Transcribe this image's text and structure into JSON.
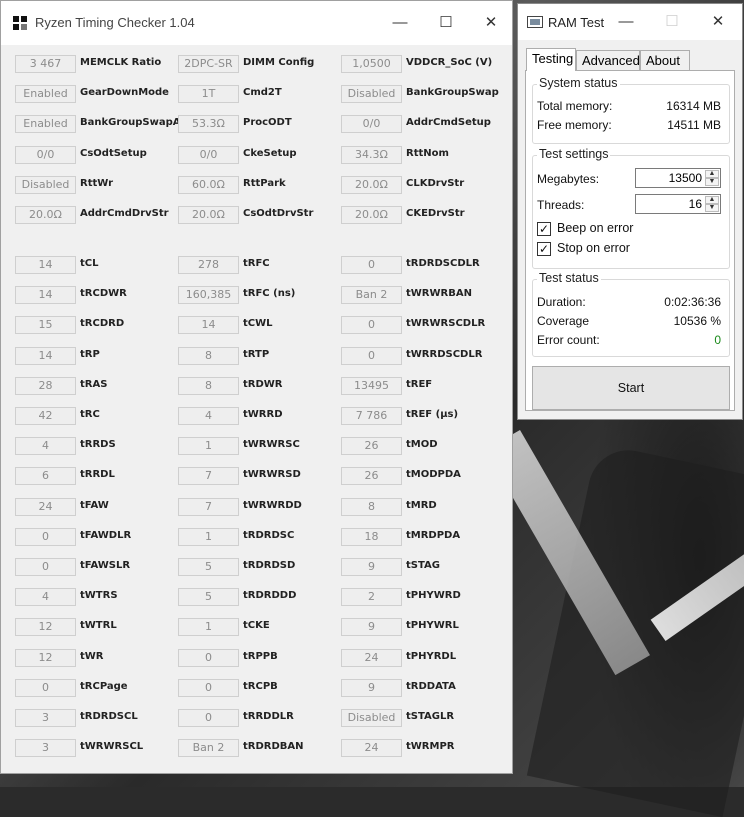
{
  "rtc": {
    "title": "Ryzen Timing Checker 1.04",
    "controls": {
      "minimize": "—",
      "maximize": "☐",
      "close": "✕"
    },
    "top_rows": [
      [
        {
          "value": "3 467",
          "label": "MEMCLK Ratio"
        },
        {
          "value": "2DPC-SR",
          "label": "DIMM Config"
        },
        {
          "value": "1,0500",
          "label": "VDDCR_SoC (V)"
        }
      ],
      [
        {
          "value": "Enabled",
          "label": "GearDownMode"
        },
        {
          "value": "1T",
          "label": "Cmd2T"
        },
        {
          "value": "Disabled",
          "label": "BankGroupSwap"
        }
      ],
      [
        {
          "value": "Enabled",
          "label": "BankGroupSwapAlt"
        },
        {
          "value": "53.3Ω",
          "label": "ProcODT"
        },
        {
          "value": "0/0",
          "label": "AddrCmdSetup"
        }
      ],
      [
        {
          "value": "0/0",
          "label": "CsOdtSetup"
        },
        {
          "value": "0/0",
          "label": "CkeSetup"
        },
        {
          "value": "34.3Ω",
          "label": "RttNom"
        }
      ],
      [
        {
          "value": "Disabled",
          "label": "RttWr"
        },
        {
          "value": "60.0Ω",
          "label": "RttPark"
        },
        {
          "value": "20.0Ω",
          "label": "CLKDrvStr"
        }
      ],
      [
        {
          "value": "20.0Ω",
          "label": "AddrCmdDrvStr"
        },
        {
          "value": "20.0Ω",
          "label": "CsOdtDrvStr"
        },
        {
          "value": "20.0Ω",
          "label": "CKEDrvStr"
        }
      ]
    ],
    "timing_rows": [
      [
        {
          "value": "14",
          "label": "tCL"
        },
        {
          "value": "278",
          "label": "tRFC"
        },
        {
          "value": "0",
          "label": "tRDRDSCDLR"
        }
      ],
      [
        {
          "value": "14",
          "label": "tRCDWR"
        },
        {
          "value": "160,385",
          "label": "tRFC (ns)"
        },
        {
          "value": "Ban 2",
          "label": "tWRWRBAN"
        }
      ],
      [
        {
          "value": "15",
          "label": "tRCDRD"
        },
        {
          "value": "14",
          "label": "tCWL"
        },
        {
          "value": "0",
          "label": "tWRWRSCDLR"
        }
      ],
      [
        {
          "value": "14",
          "label": "tRP"
        },
        {
          "value": "8",
          "label": "tRTP"
        },
        {
          "value": "0",
          "label": "tWRRDSCDLR"
        }
      ],
      [
        {
          "value": "28",
          "label": "tRAS"
        },
        {
          "value": "8",
          "label": "tRDWR"
        },
        {
          "value": "13495",
          "label": "tREF"
        }
      ],
      [
        {
          "value": "42",
          "label": "tRC"
        },
        {
          "value": "4",
          "label": "tWRRD"
        },
        {
          "value": "7 786",
          "label": "tREF (µs)"
        }
      ],
      [
        {
          "value": "4",
          "label": "tRRDS"
        },
        {
          "value": "1",
          "label": "tWRWRSC"
        },
        {
          "value": "26",
          "label": "tMOD"
        }
      ],
      [
        {
          "value": "6",
          "label": "tRRDL"
        },
        {
          "value": "7",
          "label": "tWRWRSD"
        },
        {
          "value": "26",
          "label": "tMODPDA"
        }
      ],
      [
        {
          "value": "24",
          "label": "tFAW"
        },
        {
          "value": "7",
          "label": "tWRWRDD"
        },
        {
          "value": "8",
          "label": "tMRD"
        }
      ],
      [
        {
          "value": "0",
          "label": "tFAWDLR"
        },
        {
          "value": "1",
          "label": "tRDRDSC"
        },
        {
          "value": "18",
          "label": "tMRDPDA"
        }
      ],
      [
        {
          "value": "0",
          "label": "tFAWSLR"
        },
        {
          "value": "5",
          "label": "tRDRDSD"
        },
        {
          "value": "9",
          "label": "tSTAG"
        }
      ],
      [
        {
          "value": "4",
          "label": "tWTRS"
        },
        {
          "value": "5",
          "label": "tRDRDDD"
        },
        {
          "value": "2",
          "label": "tPHYWRD"
        }
      ],
      [
        {
          "value": "12",
          "label": "tWTRL"
        },
        {
          "value": "1",
          "label": "tCKE"
        },
        {
          "value": "9",
          "label": "tPHYWRL"
        }
      ],
      [
        {
          "value": "12",
          "label": "tWR"
        },
        {
          "value": "0",
          "label": "tRPPB"
        },
        {
          "value": "24",
          "label": "tPHYRDL"
        }
      ],
      [
        {
          "value": "0",
          "label": "tRCPage"
        },
        {
          "value": "0",
          "label": "tRCPB"
        },
        {
          "value": "9",
          "label": "tRDDATA"
        }
      ],
      [
        {
          "value": "3",
          "label": "tRDRDSCL"
        },
        {
          "value": "0",
          "label": "tRRDDLR"
        },
        {
          "value": "Disabled",
          "label": "tSTAGLR"
        }
      ],
      [
        {
          "value": "3",
          "label": "tWRWRSCL"
        },
        {
          "value": "Ban 2",
          "label": "tRDRDBAN"
        },
        {
          "value": "24",
          "label": "tWRMPR"
        }
      ]
    ]
  },
  "ramtest": {
    "title": "RAM Test",
    "controls": {
      "minimize": "—",
      "maximize": "☐",
      "close": "✕"
    },
    "tabs": [
      "Testing",
      "Advanced",
      "About"
    ],
    "system_status": {
      "title": "System status",
      "total_label": "Total memory:",
      "total_value": "16314 MB",
      "free_label": "Free memory:",
      "free_value": "14511 MB"
    },
    "test_settings": {
      "title": "Test settings",
      "megabytes_label": "Megabytes:",
      "megabytes_value": "13500",
      "threads_label": "Threads:",
      "threads_value": "16",
      "beep_label": "Beep on error",
      "beep_checked": true,
      "stop_label": "Stop on error",
      "stop_checked": true,
      "check_glyph": "✓",
      "up_glyph": "▲",
      "down_glyph": "▼"
    },
    "test_status": {
      "title": "Test status",
      "duration_label": "Duration:",
      "duration_value": "0:02:36:36",
      "coverage_label": "Coverage",
      "coverage_value": "10536 %",
      "errors_label": "Error count:",
      "errors_value": "0"
    },
    "start_label": "Start"
  }
}
